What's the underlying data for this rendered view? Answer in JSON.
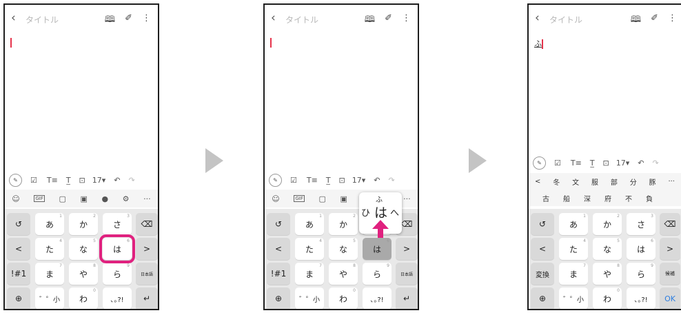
{
  "note": {
    "back_icon": "‹",
    "title_placeholder": "タイトル",
    "icons": [
      "book-icon",
      "attach-icon",
      "more-icon"
    ]
  },
  "panel3_text": "ふ",
  "toolbar": {
    "items": [
      "☑",
      "T≡",
      "T̲",
      "⊡",
      "17▾",
      "↶",
      "↷"
    ]
  },
  "iconrow": {
    "items": [
      "☺",
      "GIF",
      "▢",
      "▣",
      "🎙",
      "⚙",
      "···"
    ]
  },
  "keyboard": {
    "row1": [
      {
        "label": "↺",
        "num": ""
      },
      {
        "label": "あ",
        "num": "1"
      },
      {
        "label": "か",
        "num": "2"
      },
      {
        "label": "さ",
        "num": "3"
      },
      {
        "label": "⌫",
        "num": ""
      }
    ],
    "row2": [
      {
        "label": "<",
        "num": ""
      },
      {
        "label": "た",
        "num": "4"
      },
      {
        "label": "な",
        "num": "5"
      },
      {
        "label": "は",
        "num": "6"
      },
      {
        "label": ">",
        "num": ""
      }
    ],
    "row3": [
      {
        "label": "!#1",
        "num": ""
      },
      {
        "label": "ま",
        "num": "7"
      },
      {
        "label": "や",
        "num": "8"
      },
      {
        "label": "ら",
        "num": "9"
      },
      {
        "label": "日本語",
        "num": ""
      }
    ],
    "row4": [
      {
        "label": "⊕",
        "num": ""
      },
      {
        "label": "゛゜小",
        "num": ""
      },
      {
        "label": "わ",
        "num": "0"
      },
      {
        "label": "､｡?!",
        "num": ""
      },
      {
        "label": "↵",
        "num": ""
      }
    ],
    "row3_alt_left": "変換",
    "row3_alt_right": "候補",
    "row4_alt_right": "OK"
  },
  "flick_popup": {
    "top": "ふ",
    "left": "ひ",
    "center": "は",
    "right": "へ"
  },
  "candidates": {
    "row1": [
      "<",
      "冬",
      "文",
      "服",
      "部",
      "分",
      "豚",
      "···"
    ],
    "row2": [
      "古",
      "船",
      "深",
      "府",
      "不",
      "負"
    ]
  },
  "colors": {
    "accent": "#e0217f",
    "cursor": "#e5334b"
  }
}
